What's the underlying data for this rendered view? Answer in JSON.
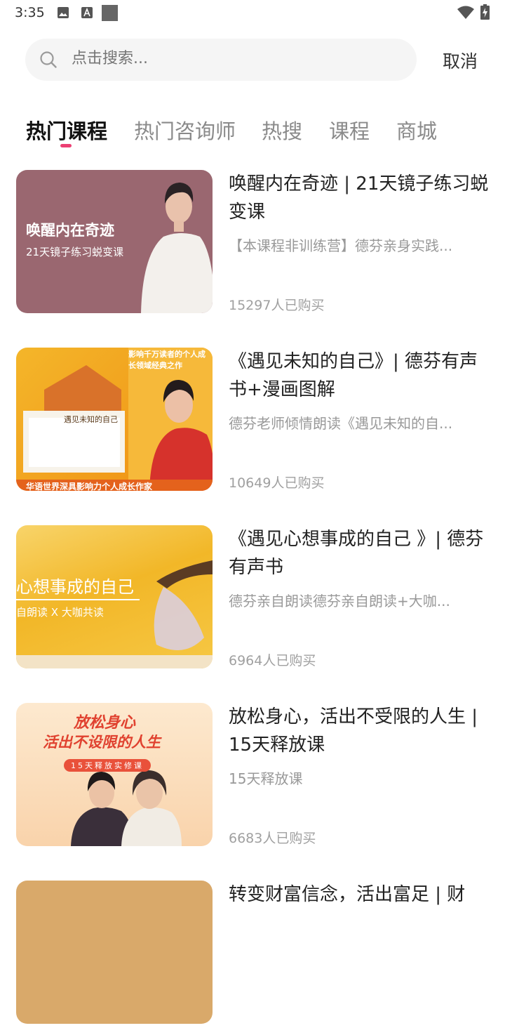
{
  "status_bar": {
    "time": "3:35"
  },
  "search": {
    "placeholder": "点击搜索...",
    "cancel_label": "取消"
  },
  "tabs": [
    {
      "label": "热门课程",
      "active": true
    },
    {
      "label": "热门咨询师",
      "active": false
    },
    {
      "label": "热搜",
      "active": false
    },
    {
      "label": "课程",
      "active": false
    },
    {
      "label": "商城",
      "active": false
    }
  ],
  "courses": [
    {
      "title": "唤醒内在奇迹 | 21天镜子练习蜕变课",
      "description": "【本课程非训练营】德芬亲身实践...",
      "purchases": "15297人已购买",
      "thumb": {
        "headline": "唤醒内在奇迹",
        "subline": "21天镜子练习蜕变课",
        "bg": "#9a6770"
      }
    },
    {
      "title": "《遇见未知的自己》| 德芬有声书+漫画图解",
      "description": "德芬老师倾情朗读《遇见未知的自...",
      "purchases": "10649人已购买",
      "thumb": {
        "headline": "影响千万读者的个人成长领域经典之作",
        "book_title": "遇见未知的自己",
        "footer": "华语世界深具影响力个人成长作家",
        "bg": "#f2a31b"
      }
    },
    {
      "title": "《遇见心想事成的自己 》| 德芬有声书",
      "description": "德芬亲自朗读德芬亲自朗读+大咖...",
      "purchases": "6964人已购买",
      "thumb": {
        "headline": "心想事成的自己",
        "subline": "自朗读   X   大咖共读",
        "bg": "#f6c13a"
      }
    },
    {
      "title": "放松身心，活出不受限的人生 | 15天释放课",
      "description": "15天释放课",
      "purchases": "6683人已购买",
      "thumb": {
        "headline": "放松身心",
        "subline": "活出不设限的人生",
        "badge": "15天释放实修课",
        "bg": "#fbe3c4"
      }
    },
    {
      "title": "转变财富信念，活出富足 | 财",
      "description": "",
      "purchases": "",
      "thumb": {
        "bg": "#d9a96a"
      }
    }
  ]
}
